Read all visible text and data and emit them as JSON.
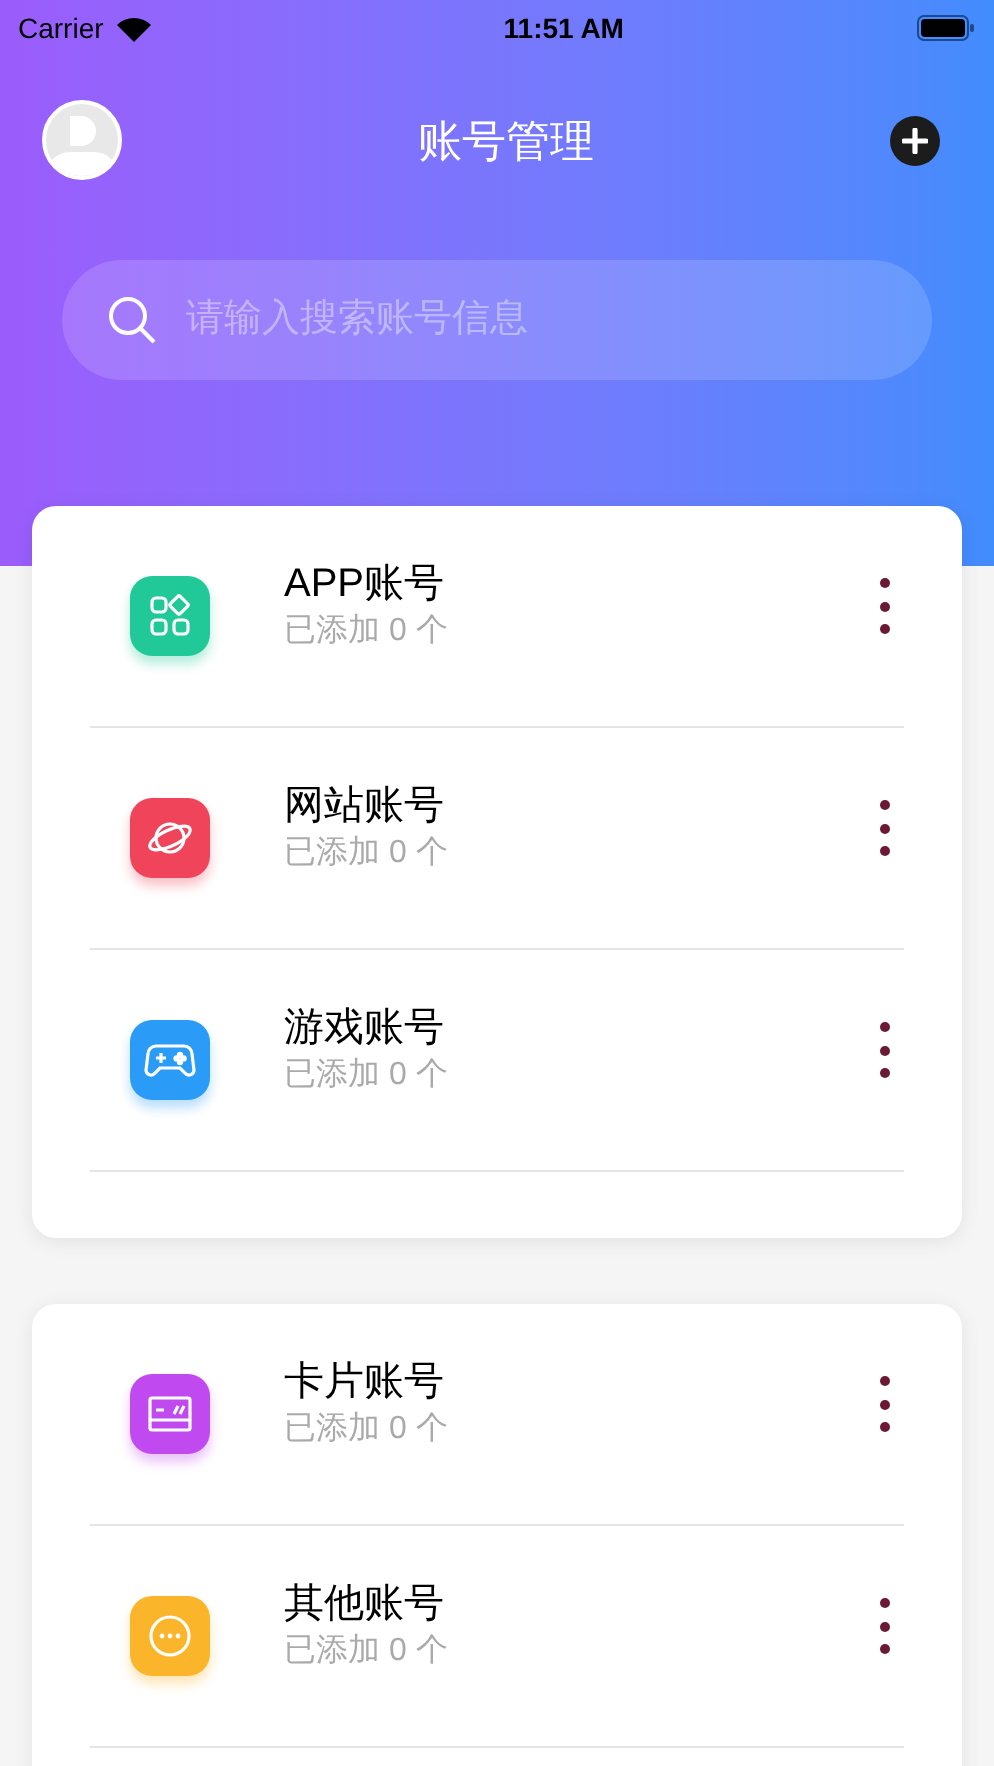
{
  "status_bar": {
    "carrier": "Carrier",
    "time": "11:51 AM"
  },
  "header": {
    "title": "账号管理"
  },
  "search": {
    "placeholder": "请输入搜索账号信息"
  },
  "groups": [
    {
      "items": [
        {
          "kind": "app",
          "color": "#20c997",
          "name": "APP账号",
          "count": "已添加 0 个"
        },
        {
          "kind": "web",
          "color": "#f0445a",
          "name": "网站账号",
          "count": "已添加 0 个"
        },
        {
          "kind": "game",
          "color": "#2a9bf7",
          "name": "游戏账号",
          "count": "已添加 0 个"
        }
      ]
    },
    {
      "items": [
        {
          "kind": "card",
          "color": "#c149f0",
          "name": "卡片账号",
          "count": "已添加 0 个"
        },
        {
          "kind": "other",
          "color": "#fbb52a",
          "name": "其他账号",
          "count": "已添加 0 个"
        }
      ]
    }
  ]
}
